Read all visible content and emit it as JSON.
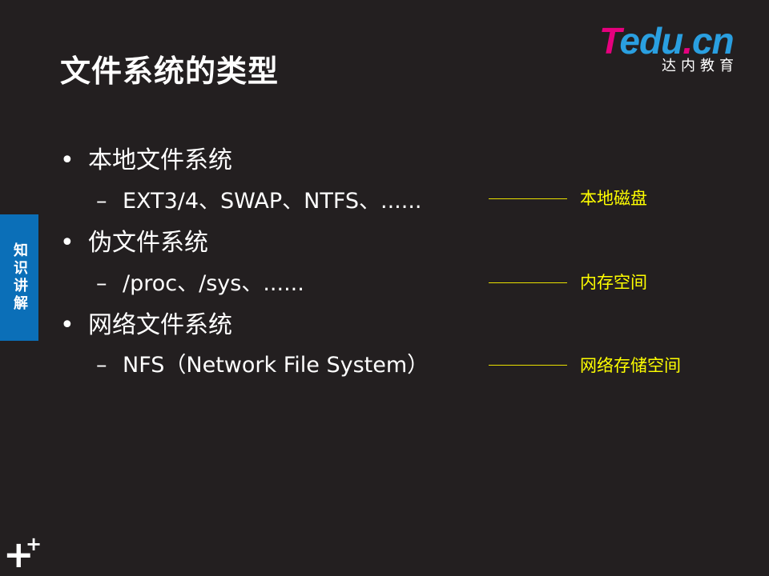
{
  "slide": {
    "title": "文件系统的类型",
    "side_tab": "知识讲解"
  },
  "logo": {
    "brand_T": "T",
    "brand_edu": "edu",
    "brand_dot": ".",
    "brand_cn": "cn",
    "subtitle": "达内教育"
  },
  "bullets": [
    {
      "symbol": "•",
      "text": "本地文件系统",
      "sub_symbol": "–",
      "sub_text": "EXT3/4、SWAP、NTFS、......",
      "note": "本地磁盘"
    },
    {
      "symbol": "•",
      "text": "伪文件系统",
      "sub_symbol": "–",
      "sub_text": "/proc、/sys、......",
      "note": "内存空间"
    },
    {
      "symbol": "•",
      "text": "网络文件系统",
      "sub_symbol": "–",
      "sub_text": "NFS（Network File System）",
      "note": "网络存储空间"
    }
  ],
  "corner": {
    "plus_big": "+",
    "plus_small": "+"
  },
  "colors": {
    "background": "#231f20",
    "side_tab": "#0b6fb8",
    "annotation": "#ffff00",
    "logo_pink": "#e6007e",
    "logo_blue": "#2a9fe0"
  }
}
